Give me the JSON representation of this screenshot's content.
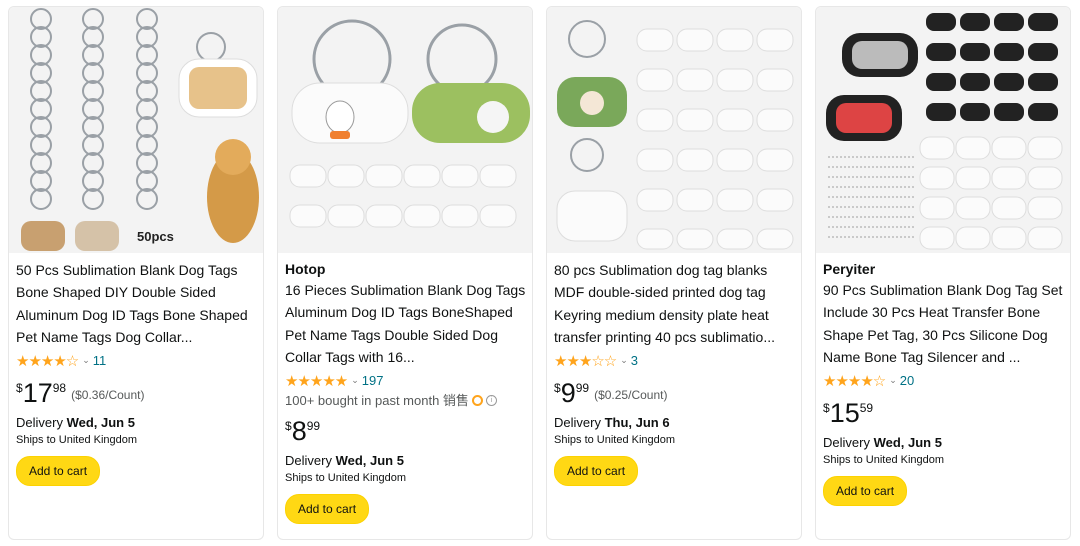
{
  "products": [
    {
      "brand": "",
      "title": "50 Pcs Sublimation Blank Dog Tags Bone Shaped DIY Double Sided Aluminum Dog ID Tags Bone Shaped Pet Name Tags Dog Collar...",
      "stars": "★★★★☆",
      "rating_count": "11",
      "bought": "",
      "price_symbol": "$",
      "price_whole": "17",
      "price_fraction": "98",
      "unit_price": "($0.36/Count)",
      "delivery_label": "Delivery",
      "delivery_date": "Wed, Jun 5",
      "ships": "Ships to United Kingdom",
      "cart_label": "Add to cart",
      "image_badge": "50pcs"
    },
    {
      "brand": "Hotop",
      "title": "16 Pieces Sublimation Blank Dog Tags Aluminum Dog ID Tags BoneShaped Pet Name Tags Double Sided Dog Collar Tags with 16...",
      "stars": "★★★★★",
      "rating_count": "197",
      "bought": "100+ bought in past month 销售",
      "price_symbol": "$",
      "price_whole": "8",
      "price_fraction": "99",
      "unit_price": "",
      "delivery_label": "Delivery",
      "delivery_date": "Wed, Jun 5",
      "ships": "Ships to United Kingdom",
      "cart_label": "Add to cart"
    },
    {
      "brand": "",
      "title": "80 pcs Sublimation dog tag blanks MDF double-sided printed dog tag Keyring medium density plate heat transfer printing 40 pcs sublimatio...",
      "stars": "★★★☆☆",
      "rating_count": "3",
      "bought": "",
      "price_symbol": "$",
      "price_whole": "9",
      "price_fraction": "99",
      "unit_price": "($0.25/Count)",
      "delivery_label": "Delivery",
      "delivery_date": "Thu, Jun 6",
      "ships": "Ships to United Kingdom",
      "cart_label": "Add to cart"
    },
    {
      "brand": "Peryiter",
      "title": "90 Pcs Sublimation Blank Dog Tag Set Include 30 Pcs Heat Transfer Bone Shape Pet Tag, 30 Pcs Silicone Dog Name Bone Tag Silencer and ...",
      "stars": "★★★★☆",
      "rating_count": "20",
      "bought": "",
      "price_symbol": "$",
      "price_whole": "15",
      "price_fraction": "59",
      "unit_price": "",
      "delivery_label": "Delivery",
      "delivery_date": "Wed, Jun 5",
      "ships": "Ships to United Kingdom",
      "cart_label": "Add to cart"
    }
  ],
  "colors": {
    "star": "#FFA41C",
    "link": "#007185",
    "button": "#FFD814"
  }
}
